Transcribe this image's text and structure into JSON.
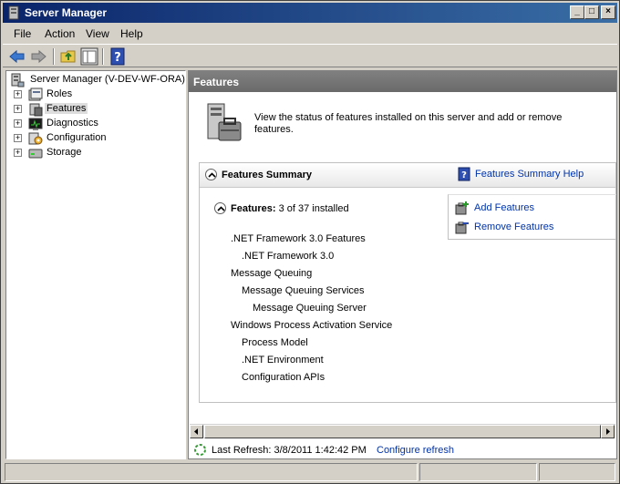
{
  "window": {
    "title": "Server Manager"
  },
  "titlebar_buttons": {
    "minimize": "_",
    "maximize": "□",
    "close": "×"
  },
  "menu": [
    "File",
    "Action",
    "View",
    "Help"
  ],
  "toolbar": {
    "icons": [
      "back-arrow-icon",
      "forward-arrow-icon",
      "up-folder-icon",
      "show-hide-console-tree-icon",
      "help-icon"
    ]
  },
  "tree": {
    "root": "Server Manager (V-DEV-WF-ORA)",
    "items": [
      {
        "label": "Roles",
        "icon": "roles-icon"
      },
      {
        "label": "Features",
        "icon": "features-icon",
        "selected": true
      },
      {
        "label": "Diagnostics",
        "icon": "diagnostics-icon"
      },
      {
        "label": "Configuration",
        "icon": "configuration-icon"
      },
      {
        "label": "Storage",
        "icon": "storage-icon"
      }
    ],
    "expander": "+"
  },
  "content": {
    "header": "Features",
    "intro": "View the status of features installed on this server and add or remove features.",
    "summary": {
      "title": "Features Summary",
      "help_link": "Features Summary Help"
    },
    "features": {
      "label": "Features:",
      "count": "3 of 37 installed",
      "list": [
        {
          "label": ".NET Framework 3.0 Features",
          "level": 0
        },
        {
          "label": ".NET Framework 3.0",
          "level": 1
        },
        {
          "label": "Message Queuing",
          "level": 0
        },
        {
          "label": "Message Queuing Services",
          "level": 1
        },
        {
          "label": "Message Queuing Server",
          "level": 2
        },
        {
          "label": "Windows Process Activation Service",
          "level": 0
        },
        {
          "label": "Process Model",
          "level": 1
        },
        {
          "label": ".NET Environment",
          "level": 1
        },
        {
          "label": "Configuration APIs",
          "level": 1
        }
      ]
    },
    "actions": {
      "add": "Add Features",
      "remove": "Remove Features"
    },
    "refresh": {
      "text": "Last Refresh: 3/8/2011 1:42:42 PM",
      "link": "Configure refresh"
    }
  },
  "colors": {
    "titlebar_start": "#0a246a",
    "titlebar_end": "#3a6ea5",
    "link": "#0033aa",
    "header_bg": "#808080"
  }
}
